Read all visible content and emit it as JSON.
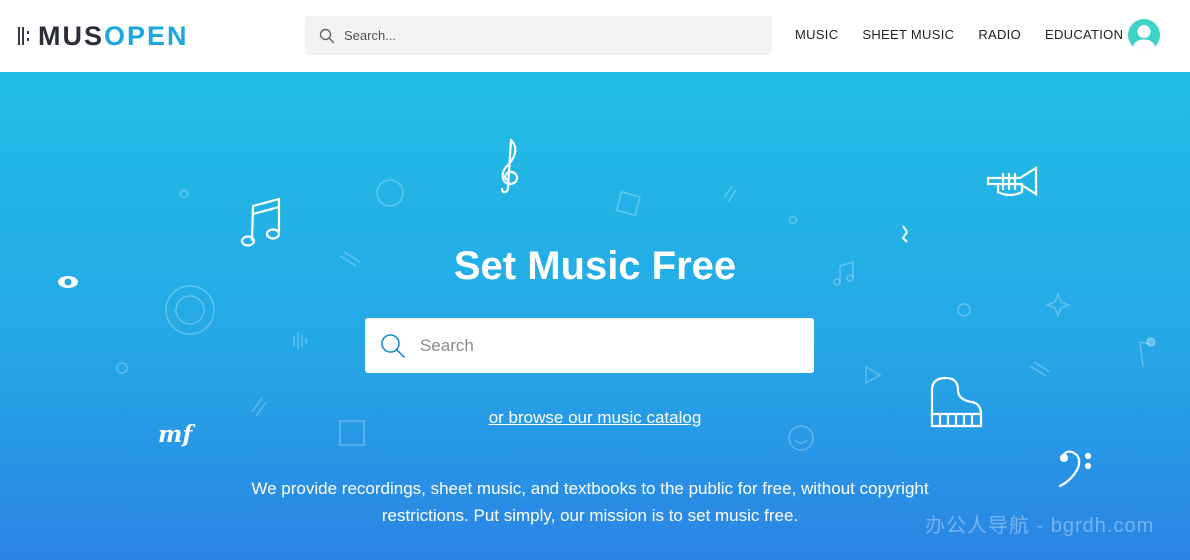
{
  "header": {
    "logo": {
      "part1": "MUS",
      "part2": "OPEN"
    },
    "search_placeholder": "Search...",
    "nav": [
      "MUSIC",
      "SHEET MUSIC",
      "RADIO",
      "EDUCATION"
    ]
  },
  "hero": {
    "title": "Set Music Free",
    "search_placeholder": "Search",
    "browse_link": "or browse our music catalog",
    "description_line1": "We provide recordings, sheet music, and textbooks to the public for free, without copyright",
    "description_line2": "restrictions. Put simply, our mission is to set music free.",
    "watermark": "办公人导航 - bgrdh.com"
  },
  "icons": [
    "search-icon",
    "avatar-icon",
    "treble-clef-icon",
    "bass-clef-icon",
    "music-notes-icon",
    "trumpet-icon",
    "piano-icon",
    "mf-dynamic-icon"
  ],
  "colors": {
    "brand_blue": "#1aa8e0",
    "hero_top": "#21bde6",
    "hero_bottom": "#2b84e5",
    "avatar": "#3ed3c6"
  }
}
